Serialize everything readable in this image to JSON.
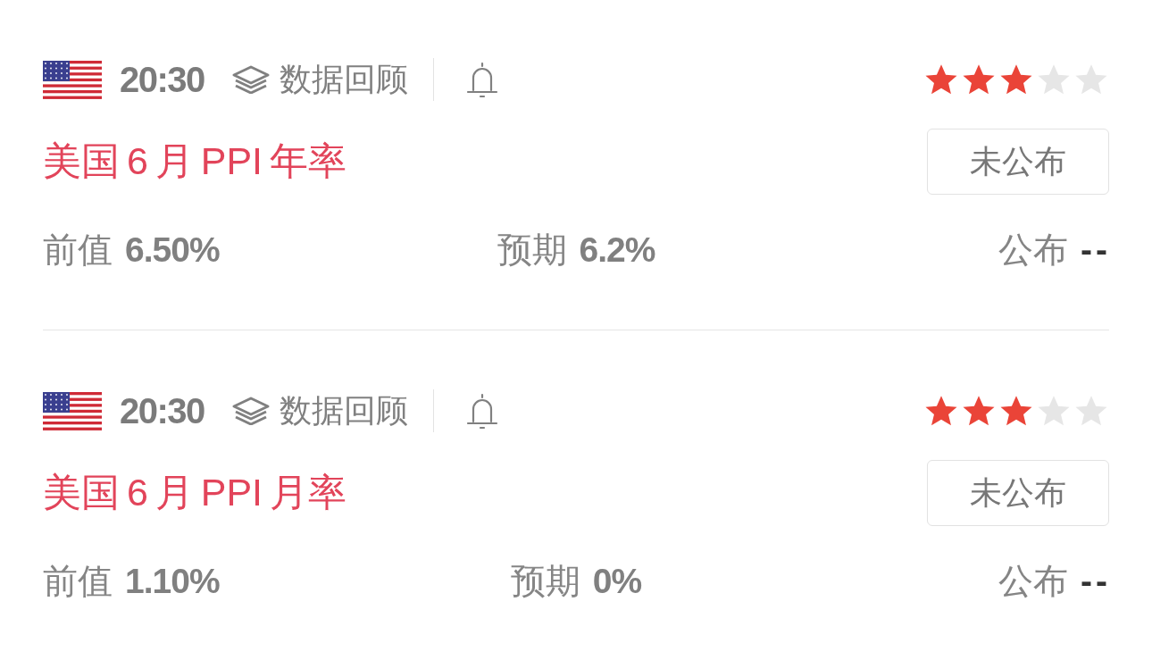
{
  "events": [
    {
      "time": "20:30",
      "review_label": "数据回顾",
      "stars": 3,
      "title": "美国 6 月 PPI 年率",
      "status_button": "未公布",
      "previous": {
        "label": "前值",
        "value": "6.50%"
      },
      "forecast": {
        "label": "预期",
        "value": "6.2%"
      },
      "actual": {
        "label": "公布",
        "value": "--"
      }
    },
    {
      "time": "20:30",
      "review_label": "数据回顾",
      "stars": 3,
      "title": "美国 6 月 PPI 月率",
      "status_button": "未公布",
      "previous": {
        "label": "前值",
        "value": "1.10%"
      },
      "forecast": {
        "label": "预期",
        "value": "0%"
      },
      "actual": {
        "label": "公布",
        "value": "--"
      }
    }
  ]
}
